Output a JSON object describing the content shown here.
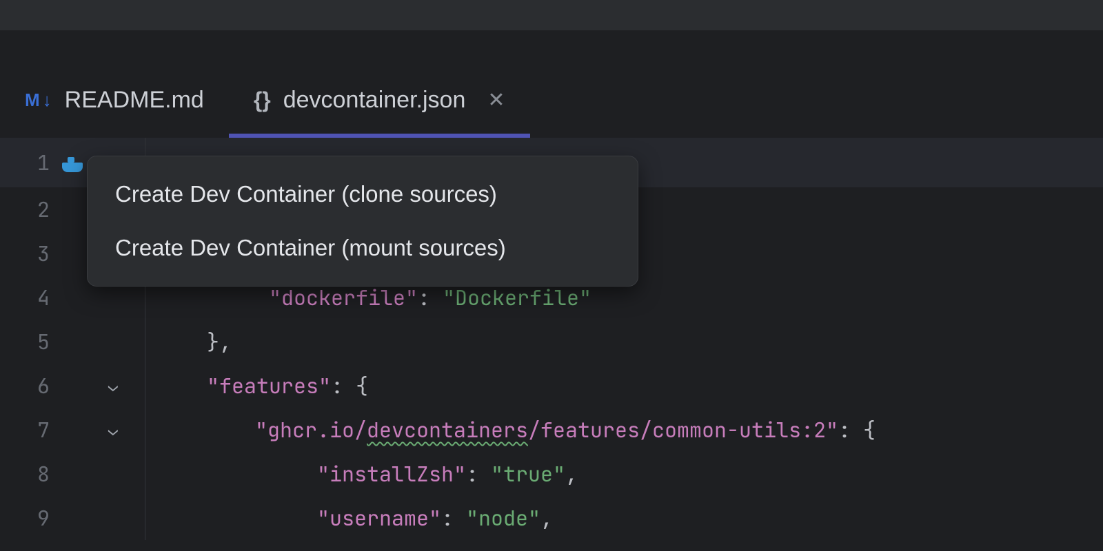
{
  "tabs": [
    {
      "label": "README.md",
      "icon": "markdown",
      "active": false,
      "closable": false
    },
    {
      "label": "devcontainer.json",
      "icon": "braces",
      "active": true,
      "closable": true
    }
  ],
  "popup": {
    "items": [
      "Create Dev Container (clone sources)",
      "Create Dev Container (mount sources)"
    ]
  },
  "gutter": {
    "lines": [
      "1",
      "2",
      "3",
      "4",
      "5",
      "6",
      "7",
      "8",
      "9"
    ],
    "folds": {
      "6": true,
      "7": true
    },
    "icon_on_line": 1,
    "icon_name": "docker-icon"
  },
  "code": {
    "l4": {
      "key": "\"dockerfile\"",
      "colon": ": ",
      "val": "\"Dockerfile\""
    },
    "l5": {
      "text": "},"
    },
    "l6": {
      "key": "\"features\"",
      "colon": ": ",
      "brace": "{"
    },
    "l7": {
      "key_full": "\"ghcr.io/devcontainers/features/common-utils:2\"",
      "key_seg_a": "\"ghcr.io/",
      "key_seg_b": "devcontainers",
      "key_seg_c": "/features/common-utils:2\"",
      "colon": ": ",
      "brace": "{"
    },
    "l8": {
      "key": "\"installZsh\"",
      "colon": ": ",
      "val": "\"true\"",
      "comma": ","
    },
    "l9": {
      "key": "\"username\"",
      "colon": ": ",
      "val": "\"node\"",
      "comma": ","
    }
  }
}
